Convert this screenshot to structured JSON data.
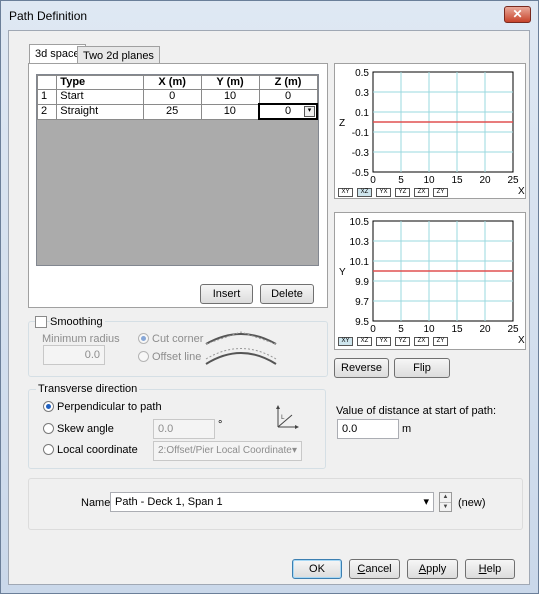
{
  "window": {
    "title": "Path Definition",
    "close_label": "✕"
  },
  "tabs": [
    {
      "label": "3d space"
    },
    {
      "label": "Two 2d planes"
    }
  ],
  "grid": {
    "headers": [
      "",
      "Type",
      "X (m)",
      "Y (m)",
      "Z (m)"
    ],
    "rows": [
      {
        "index": "1",
        "type": "Start",
        "x": "0",
        "y": "10",
        "z": "0"
      },
      {
        "index": "2",
        "type": "Straight",
        "x": "25",
        "y": "10",
        "z": "0"
      }
    ]
  },
  "buttons": {
    "insert": "Insert",
    "delete": "Delete",
    "reverse": "Reverse",
    "flip": "Flip",
    "ok": "OK",
    "cancel_pre": "",
    "cancel_ul": "C",
    "cancel_post": "ancel",
    "apply_pre": "",
    "apply_ul": "A",
    "apply_post": "pply",
    "help_pre": "",
    "help_ul": "H",
    "help_post": "elp"
  },
  "smoothing": {
    "label": "Smoothing",
    "checked": false,
    "min_radius_label": "Minimum radius",
    "min_radius_value": "0.0",
    "cut_corner": "Cut corner",
    "offset_line": "Offset line"
  },
  "transverse": {
    "legend": "Transverse direction",
    "perpendicular": "Perpendicular to path",
    "skew": "Skew angle",
    "skew_value": "0.0",
    "degree": "°",
    "local": "Local coordinate",
    "local_value": "2:Offset/Pier Local Coordinate"
  },
  "distance": {
    "label": "Value of distance at start of path:",
    "value": "0.0",
    "unit": "m"
  },
  "name_row": {
    "label": "Name",
    "value": "Path - Deck 1, Span 1",
    "suffix": "(new)"
  },
  "view_buttons": [
    "XY",
    "XZ",
    "YX",
    "YZ",
    "ZX",
    "ZY"
  ],
  "chart_data": [
    {
      "type": "line",
      "xlabel": "X",
      "ylabel": "Z",
      "xlim": [
        0,
        25
      ],
      "ylim": [
        -0.5,
        0.5
      ],
      "xticks": [
        "0",
        "5",
        "10",
        "15",
        "20",
        "25"
      ],
      "yticks": [
        "0.5",
        "0.3",
        "0.1",
        "-0.1",
        "-0.3",
        "-0.5"
      ],
      "series": [
        {
          "x": [
            0,
            25
          ],
          "y": [
            0,
            0
          ],
          "color": "#e05050"
        }
      ],
      "grid": true,
      "selected_view": "XZ"
    },
    {
      "type": "line",
      "xlabel": "X",
      "ylabel": "Y",
      "xlim": [
        0,
        25
      ],
      "ylim": [
        9.5,
        10.5
      ],
      "xticks": [
        "0",
        "5",
        "10",
        "15",
        "20",
        "25"
      ],
      "yticks": [
        "10.5",
        "10.3",
        "10.1",
        "9.9",
        "9.7",
        "9.5"
      ],
      "series": [
        {
          "x": [
            0,
            25
          ],
          "y": [
            10,
            10
          ],
          "color": "#e05050"
        }
      ],
      "grid": true,
      "selected_view": "XY"
    }
  ]
}
